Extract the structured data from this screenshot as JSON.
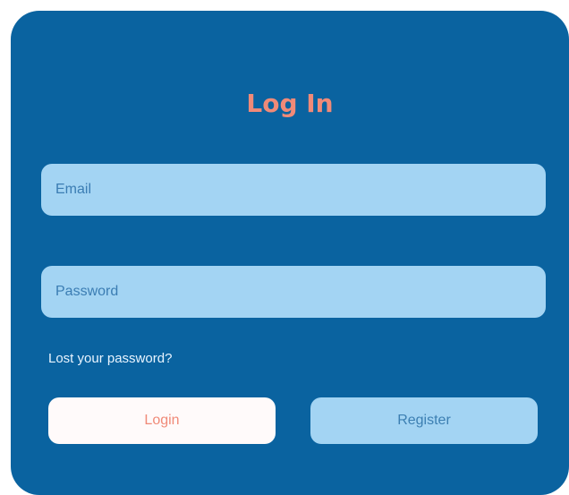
{
  "form": {
    "title": "Log In",
    "email": {
      "placeholder": "Email",
      "value": ""
    },
    "password": {
      "placeholder": "Password",
      "value": ""
    },
    "lost_password_label": "Lost your password?",
    "login_label": "Login",
    "register_label": "Register"
  },
  "colors": {
    "card_background": "#0a63a0",
    "title": "#f08a78",
    "field_background": "#a3d4f3",
    "login_button_background": "#fffafa",
    "login_button_text": "#f08a78",
    "register_button_background": "#a3d4f3",
    "register_button_text": "#3c7fb2"
  }
}
